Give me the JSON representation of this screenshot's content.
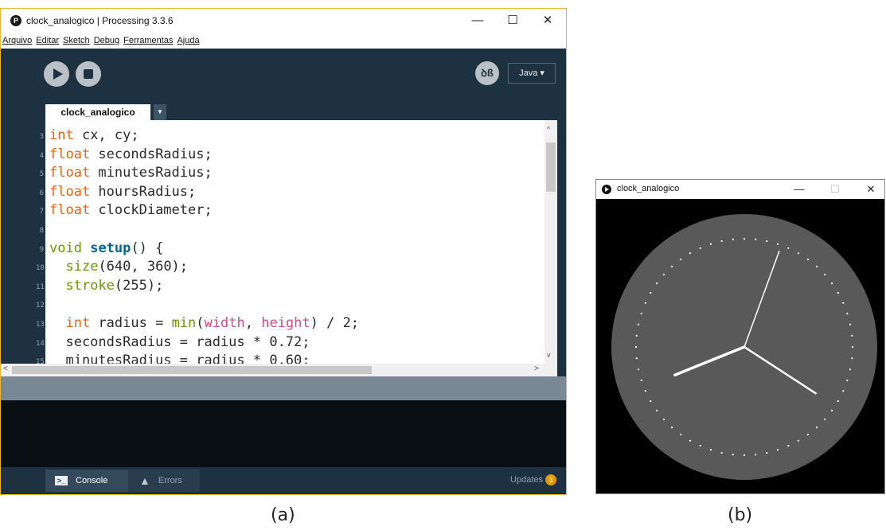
{
  "ide": {
    "window_title": "clock_analogico | Processing 3.3.6",
    "app_icon_glyph": "P",
    "controls": {
      "minimize": "—",
      "maximize": "☐",
      "close": "✕"
    },
    "menu": [
      "Arquivo",
      "Editar",
      "Sketch",
      "Debug",
      "Ferramentas",
      "Ajuda"
    ],
    "toolbar": {
      "debug_glyph": "ꝺß",
      "mode_label": "Java ▾"
    },
    "tab": {
      "name": "clock_analogico",
      "arrow": "▼"
    },
    "code": [
      {
        "line": "3",
        "tokens": [
          [
            "kw",
            "int"
          ],
          [
            "p",
            " cx, cy;"
          ]
        ]
      },
      {
        "line": "4",
        "tokens": [
          [
            "kw",
            "float"
          ],
          [
            "p",
            " secondsRadius;"
          ]
        ]
      },
      {
        "line": "5",
        "tokens": [
          [
            "kw",
            "float"
          ],
          [
            "p",
            " minutesRadius;"
          ]
        ]
      },
      {
        "line": "6",
        "tokens": [
          [
            "kw",
            "float"
          ],
          [
            "p",
            " hoursRadius;"
          ]
        ]
      },
      {
        "line": "7",
        "tokens": [
          [
            "kw",
            "float"
          ],
          [
            "p",
            " clockDiameter;"
          ]
        ]
      },
      {
        "line": "8",
        "tokens": []
      },
      {
        "line": "9",
        "tokens": [
          [
            "bi",
            "void"
          ],
          [
            "p",
            " "
          ],
          [
            "fn",
            "setup"
          ],
          [
            "p",
            "() {"
          ]
        ]
      },
      {
        "line": "10",
        "tokens": [
          [
            "p",
            "  "
          ],
          [
            "bi",
            "size"
          ],
          [
            "p",
            "(640, 360);"
          ]
        ]
      },
      {
        "line": "11",
        "tokens": [
          [
            "p",
            "  "
          ],
          [
            "bi",
            "stroke"
          ],
          [
            "p",
            "(255);"
          ]
        ]
      },
      {
        "line": "12",
        "tokens": []
      },
      {
        "line": "13",
        "tokens": [
          [
            "p",
            "  "
          ],
          [
            "kw",
            "int"
          ],
          [
            "p",
            " radius = "
          ],
          [
            "bi",
            "min"
          ],
          [
            "p",
            "("
          ],
          [
            "lit",
            "width"
          ],
          [
            "p",
            ", "
          ],
          [
            "lit",
            "height"
          ],
          [
            "p",
            ") / 2;"
          ]
        ]
      },
      {
        "line": "14",
        "tokens": [
          [
            "p",
            "  secondsRadius = radius * 0.72;"
          ]
        ]
      },
      {
        "line": "15",
        "tokens": [
          [
            "p",
            "  minutesRadius = radius * 0.60;"
          ]
        ]
      }
    ],
    "scroll_glyphs": {
      "up": "^",
      "down": "v",
      "left": "<",
      "right": ">"
    },
    "footer": {
      "console_glyph": ">_",
      "console_label": "Console",
      "errors_glyph": "▲",
      "errors_label": "Errors",
      "updates_label": "Updates",
      "updates_count": "3"
    }
  },
  "sketch": {
    "window_title": "clock_analogico",
    "controls": {
      "minimize": "—",
      "maximize": "☐",
      "close": "✕"
    },
    "clock": {
      "hours_angle_deg": 248,
      "minutes_angle_deg": 123,
      "seconds_angle_deg": 20,
      "face_color": "#595959",
      "background_color": "#000000",
      "hand_color": "#ffffff"
    }
  },
  "captions": {
    "a": "(a)",
    "b": "(b)"
  },
  "colors": {
    "ide_dark": "#1e3140",
    "keyword": "#e2661a",
    "function": "#006699",
    "builtin": "#669900",
    "literal": "#d94a7a",
    "window_border": "#e7b43a"
  }
}
